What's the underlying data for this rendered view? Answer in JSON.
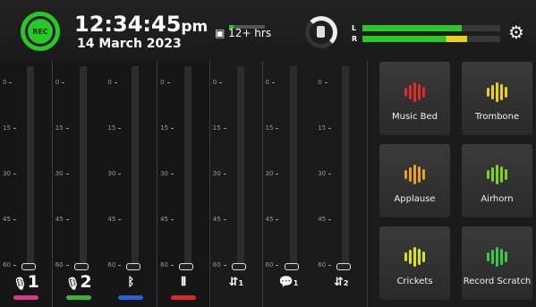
{
  "header": {
    "rec_label": "REC",
    "time": "12:34:45",
    "time_ampm": "pm",
    "date": "14 March 2023",
    "storage_remaining": "12+ hrs",
    "storage_level": 0.12,
    "usb_icon": "usb-drive-icon",
    "monitor_icon": "speaker-icon",
    "level_L_label": "L",
    "level_R_label": "R",
    "level_L": 0.72,
    "level_R": 0.76,
    "settings_icon": "gear-icon"
  },
  "channels": [
    {
      "name": "mic-1",
      "label": "1",
      "icon": "mic-icon",
      "color": "#d63a8a",
      "ticks": [
        "0",
        "15",
        "30",
        "45",
        "60"
      ]
    },
    {
      "name": "mic-2",
      "label": "2",
      "icon": "mic-icon",
      "color": "#39b33c",
      "ticks": [
        "0",
        "15",
        "30",
        "45",
        "60"
      ]
    },
    {
      "name": "bluetooth",
      "label": "",
      "icon": "bluetooth-icon",
      "color": "#2b5ed9",
      "ticks": [
        "0",
        "15",
        "30",
        "45",
        "60"
      ]
    },
    {
      "name": "sound-pads",
      "label": "",
      "icon": "waveform-icon",
      "color": "#d22b2b",
      "ticks": [
        "0",
        "15",
        "30",
        "45",
        "60"
      ]
    },
    {
      "name": "usb-1",
      "label": "1",
      "icon": "usb-icon",
      "color": "",
      "ticks": [
        "0",
        "15",
        "30",
        "45",
        "60"
      ]
    },
    {
      "name": "chat-1",
      "label": "1",
      "icon": "chat-icon",
      "color": "",
      "ticks": [
        "0",
        "15",
        "30",
        "45",
        "60"
      ]
    },
    {
      "name": "usb-2",
      "label": "2",
      "icon": "usb-icon",
      "color": "",
      "ticks": [
        "0",
        "15",
        "30",
        "45",
        "60"
      ]
    }
  ],
  "pads": [
    {
      "label": "Music Bed",
      "color": "#e02b2b"
    },
    {
      "label": "Trombone",
      "color": "#e8d21f"
    },
    {
      "label": "Applause",
      "color": "#e8a01f"
    },
    {
      "label": "Airhorn",
      "color": "#7ed321"
    },
    {
      "label": "Crickets",
      "color": "#d8e21f"
    },
    {
      "label": "Record Scratch",
      "color": "#3ac84a"
    }
  ]
}
